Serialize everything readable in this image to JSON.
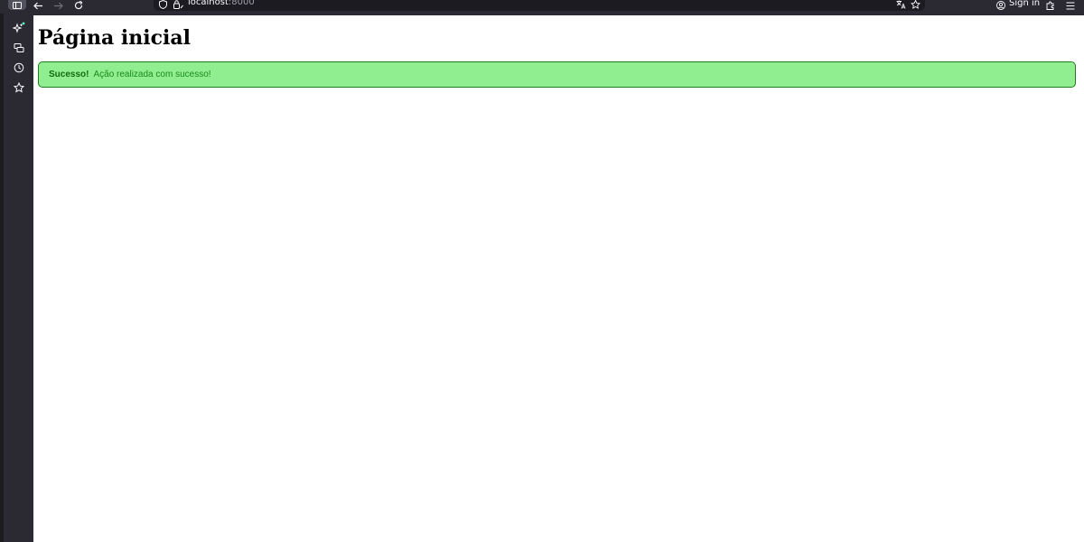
{
  "browser": {
    "url_host": "localhost",
    "url_port": ":8000",
    "signin_label": "Sign in"
  },
  "page": {
    "title": "Página inicial",
    "alert": {
      "strong": "Sucesso!",
      "message": "Ação realizada com sucesso!"
    }
  },
  "colors": {
    "alert_background": "#90ee90",
    "alert_border": "#1e7d1e",
    "alert_text": "#1a8a1a"
  }
}
